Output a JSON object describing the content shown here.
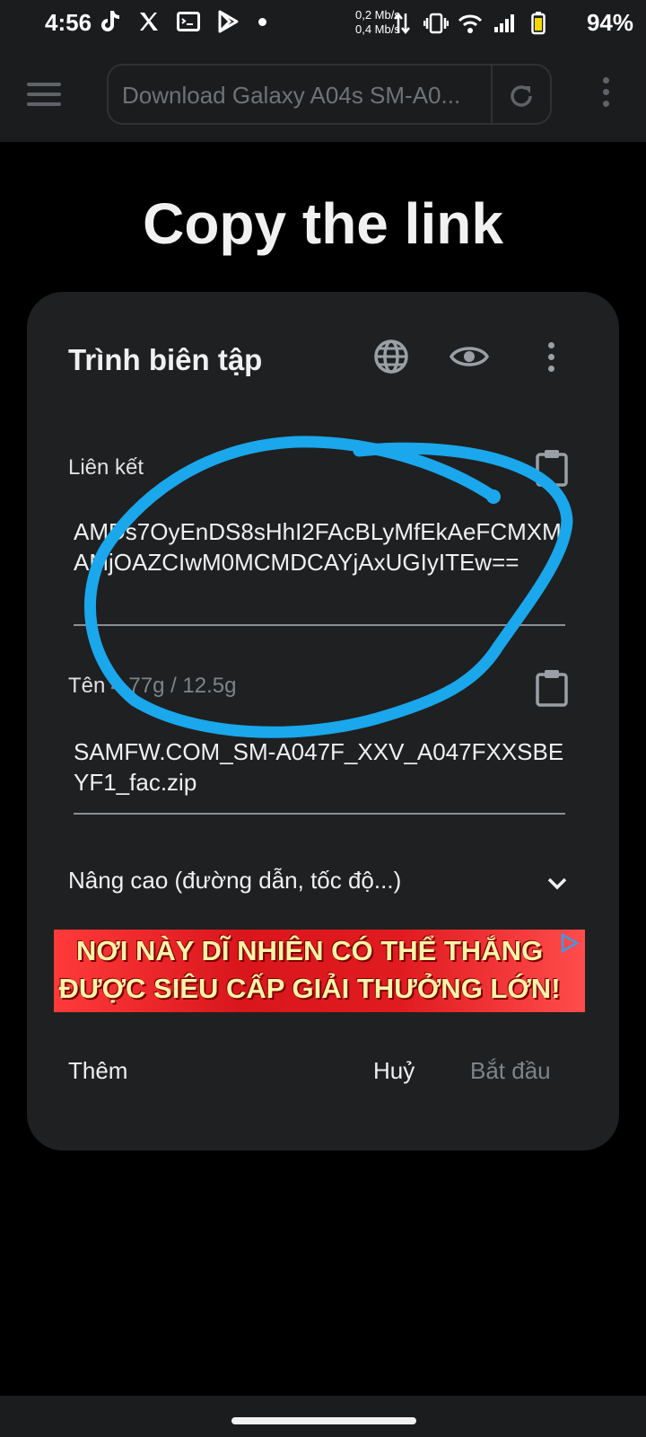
{
  "status_bar": {
    "time": "4:56",
    "speed_up": "0,2 Mb/s",
    "speed_down": "0,4 Mb/s",
    "battery": "94%"
  },
  "toolbar": {
    "url": "Download Galaxy A04s SM-A0..."
  },
  "heading": "Copy the link",
  "dialog": {
    "title": "Trình biên tập",
    "link_label": "Liên kết",
    "link_value": "AMDs7OyEnDS8sHhI2FAcBLyMfEkAeFCMXMAMjOAZCIwM0MCMDCAYjAxUGIyITEw==",
    "name_label": "Tên",
    "name_size": "4.77g / 12.5g",
    "name_value": "SAMFW.COM_SM-A047F_XXV_A047FXXSBEYF1_fac.zip",
    "advanced": "Nâng cao (đường dẫn, tốc độ...)",
    "ad_line1": "NƠI NÀY DĨ NHIÊN CÓ THỂ THẮNG",
    "ad_line2": "ĐƯỢC SIÊU CẤP GIẢI THƯỞNG LỚN!",
    "btn_more": "Thêm",
    "btn_cancel": "Huỷ",
    "btn_start": "Bắt đầu"
  },
  "colors": {
    "background": "#000000",
    "surface": "#1f2021",
    "annotation": "#1aa7ec"
  }
}
